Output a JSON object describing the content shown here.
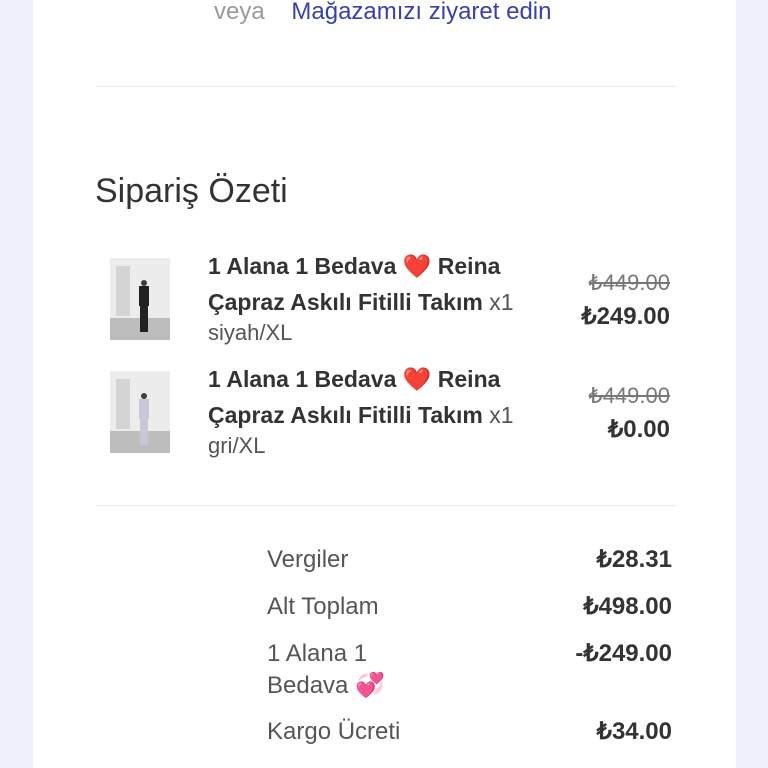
{
  "header": {
    "or_text": "veya",
    "visit_store_link": "Mağazamızı ziyaret edin"
  },
  "order_summary": {
    "title": "Sipariş Özeti",
    "items": [
      {
        "name_part1": "1 Alana 1 Bedava",
        "heart": "❤️",
        "name_part2": "Reina Çapraz Askılı Fitilli Takım",
        "quantity": "x1",
        "variant": "siyah/XL",
        "original_price": "₺449.00",
        "price": "₺249.00"
      },
      {
        "name_part1": "1 Alana 1 Bedava",
        "heart": "❤️",
        "name_part2": "Reina Çapraz Askılı Fitilli Takım",
        "quantity": "x1",
        "variant": "gri/XL",
        "original_price": "₺449.00",
        "price": "₺0.00"
      }
    ],
    "totals": [
      {
        "label": "Vergiler",
        "value": "₺28.31"
      },
      {
        "label": "Alt Toplam",
        "value": "₺498.00"
      },
      {
        "label": "1 Alana 1 Bedava 💞",
        "value": "-₺249.00"
      },
      {
        "label": "Kargo Ücreti",
        "value": "₺34.00"
      }
    ]
  },
  "colors": {
    "link": "#3a3fb0",
    "background": "#eff0fb",
    "card": "#ffffff",
    "heart": "#e0202a"
  }
}
